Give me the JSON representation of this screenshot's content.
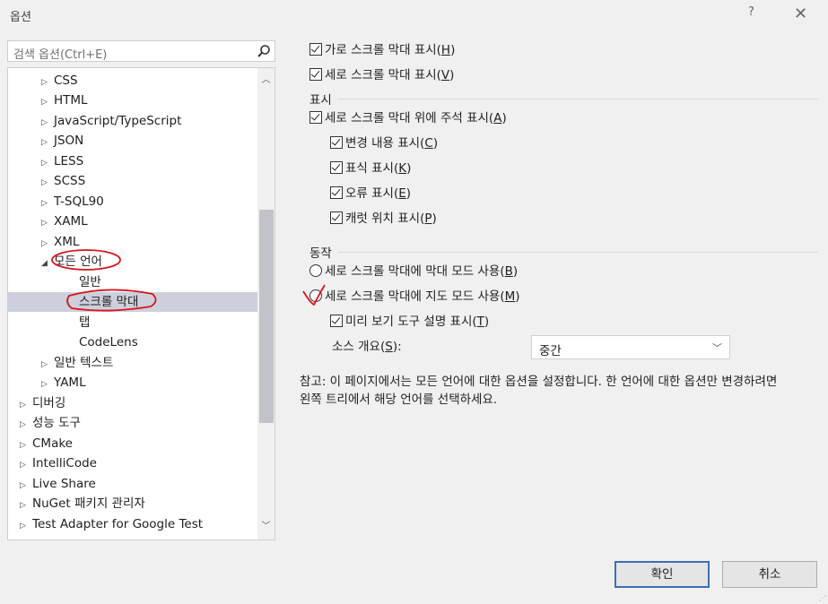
{
  "window": {
    "title": "옵션",
    "help": "?",
    "close": "✕"
  },
  "search": {
    "placeholder": "검색 옵션(Ctrl+E)"
  },
  "tree": {
    "items": [
      {
        "label": "CSS",
        "arrow": "▷"
      },
      {
        "label": "HTML",
        "arrow": "▷"
      },
      {
        "label": "JavaScript/TypeScript",
        "arrow": "▷"
      },
      {
        "label": "JSON",
        "arrow": "▷"
      },
      {
        "label": "LESS",
        "arrow": "▷"
      },
      {
        "label": "SCSS",
        "arrow": "▷"
      },
      {
        "label": "T-SQL90",
        "arrow": "▷"
      },
      {
        "label": "XAML",
        "arrow": "▷"
      },
      {
        "label": "XML",
        "arrow": "▷"
      },
      {
        "label": "모든 언어",
        "arrow": "◢"
      },
      {
        "label": "일반"
      },
      {
        "label": "스크롤 막대"
      },
      {
        "label": "탭"
      },
      {
        "label": "CodeLens"
      },
      {
        "label": "일반 텍스트",
        "arrow": "▷"
      },
      {
        "label": "YAML",
        "arrow": "▷"
      },
      {
        "label": "디버깅",
        "arrow": "▷"
      },
      {
        "label": "성능 도구",
        "arrow": "▷"
      },
      {
        "label": "CMake",
        "arrow": "▷"
      },
      {
        "label": "IntelliCode",
        "arrow": "▷"
      },
      {
        "label": "Live Share",
        "arrow": "▷"
      },
      {
        "label": "NuGet 패키지 관리자",
        "arrow": "▷"
      },
      {
        "label": "Test Adapter for Google Test",
        "arrow": "▷"
      }
    ]
  },
  "options": {
    "h_scroll": {
      "text": "가로 스크롤 막대 표시(",
      "key": "H",
      "end": ")",
      "checked": true
    },
    "v_scroll": {
      "text": "세로 스크롤 막대 표시(",
      "key": "V",
      "end": ")",
      "checked": true
    },
    "display_group": "표시",
    "annotations": {
      "text": "세로 스크롤 막대 위에 주석 표시(",
      "key": "A",
      "end": ")",
      "checked": true
    },
    "changes": {
      "text": "변경 내용 표시(",
      "key": "C",
      "end": ")",
      "checked": true
    },
    "marks": {
      "text": "표식 표시(",
      "key": "K",
      "end": ")",
      "checked": true
    },
    "errors": {
      "text": "오류 표시(",
      "key": "E",
      "end": ")",
      "checked": true
    },
    "caret": {
      "text": "캐럿 위치 표시(",
      "key": "P",
      "end": ")",
      "checked": true
    },
    "behavior_group": "동작",
    "bar_mode": {
      "text": "세로 스크롤 막대에 막대 모드 사용(",
      "key": "B",
      "end": ")",
      "selected": false
    },
    "map_mode": {
      "text": "세로 스크롤 막대에 지도 모드 사용(",
      "key": "M",
      "end": ")",
      "selected": true
    },
    "preview": {
      "text": "미리 보기 도구 설명 표시(",
      "key": "T",
      "end": ")",
      "checked": true
    },
    "overview_label": {
      "text": "소스 개요(",
      "key": "S",
      "end": "):"
    },
    "overview_value": "중간"
  },
  "note": "참고: 이 페이지에서는 모든 언어에 대한 옵션을 설정합니다. 한 언어에 대한 옵션만 변경하려면 왼쪽 트리에서 해당 언어를 선택하세요.",
  "buttons": {
    "ok": "확인",
    "cancel": "취소"
  }
}
